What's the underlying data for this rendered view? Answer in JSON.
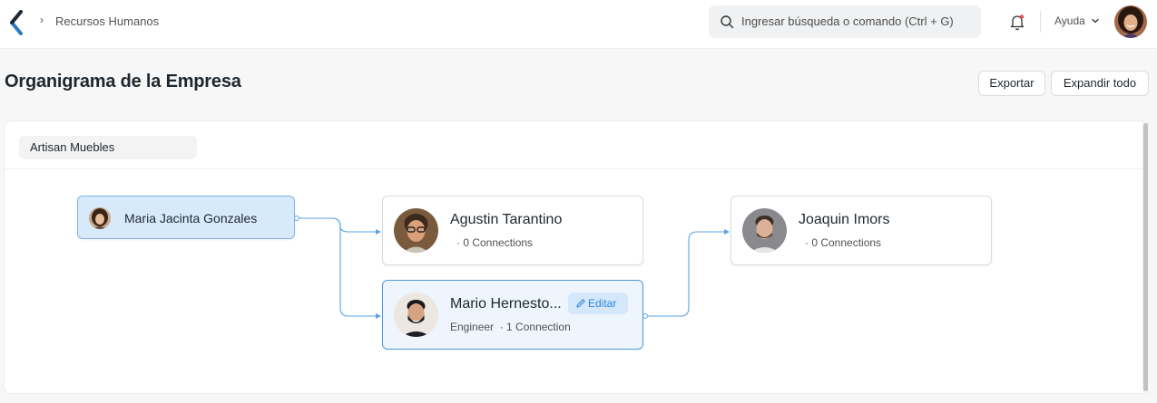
{
  "navbar": {
    "breadcrumb": "Recursos Humanos",
    "search_placeholder": "Ingresar búsqueda o comando (Ctrl + G)",
    "help_label": "Ayuda",
    "icons": [
      "app-logo-icon",
      "chevron-right-icon",
      "search-icon",
      "bell-icon",
      "chevron-down-icon"
    ]
  },
  "page": {
    "title": "Organigrama de la Empresa",
    "export_label": "Exportar",
    "expand_label": "Expandir todo"
  },
  "chart": {
    "company": "Artisan Muebles",
    "root": {
      "name": "Maria Jacinta Gonzales"
    },
    "nodes": [
      {
        "name": "Agustin Tarantino",
        "designation": "",
        "connections": "· 0 Connections"
      },
      {
        "name": "Mario Hernesto...",
        "designation": "Engineer",
        "connections": "· 1 Connection",
        "edit_label": "Editar"
      },
      {
        "name": "Joaquin Imors",
        "designation": "",
        "connections": "· 0 Connections"
      }
    ]
  },
  "colors": {
    "accent": "#2f86d6",
    "active_node_bg": "#d7eafc",
    "active_node_border": "#7fb3e6",
    "connector": "#5aa3e2",
    "notification_dot": "#e24c4c"
  }
}
